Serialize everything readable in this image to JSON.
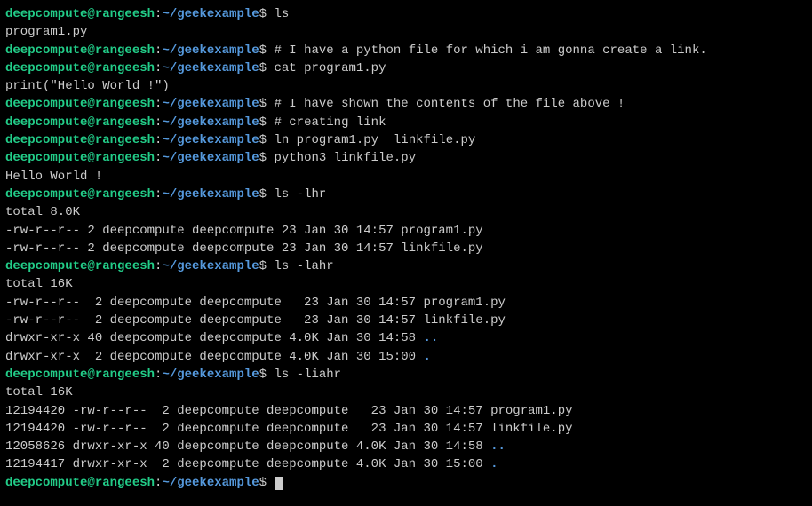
{
  "prompt": {
    "user_host": "deepcompute@rangeesh",
    "colon": ":",
    "path": "~/geekexample",
    "dollar": "$"
  },
  "lines": [
    {
      "type": "prompt",
      "cmd": "ls"
    },
    {
      "type": "output",
      "text": "program1.py"
    },
    {
      "type": "prompt",
      "cmd": "# I have a python file for which i am gonna create a link."
    },
    {
      "type": "prompt",
      "cmd": "cat program1.py"
    },
    {
      "type": "output",
      "text": "print(\"Hello World !\")"
    },
    {
      "type": "prompt",
      "cmd": "# I have shown the contents of the file above !"
    },
    {
      "type": "prompt",
      "cmd": "# creating link"
    },
    {
      "type": "prompt",
      "cmd": "ln program1.py  linkfile.py"
    },
    {
      "type": "prompt",
      "cmd": "python3 linkfile.py"
    },
    {
      "type": "output",
      "text": "Hello World !"
    },
    {
      "type": "prompt",
      "cmd": "ls -lhr"
    },
    {
      "type": "output",
      "text": "total 8.0K"
    },
    {
      "type": "output",
      "text": "-rw-r--r-- 2 deepcompute deepcompute 23 Jan 30 14:57 program1.py"
    },
    {
      "type": "output",
      "text": "-rw-r--r-- 2 deepcompute deepcompute 23 Jan 30 14:57 linkfile.py"
    },
    {
      "type": "prompt",
      "cmd": "ls -lahr"
    },
    {
      "type": "output",
      "text": "total 16K"
    },
    {
      "type": "output",
      "text": "-rw-r--r--  2 deepcompute deepcompute   23 Jan 30 14:57 program1.py"
    },
    {
      "type": "output",
      "text": "-rw-r--r--  2 deepcompute deepcompute   23 Jan 30 14:57 linkfile.py"
    },
    {
      "type": "output-dir",
      "prefix": "drwxr-xr-x 40 deepcompute deepcompute 4.0K Jan 30 14:58 ",
      "dir": ".."
    },
    {
      "type": "output-dir",
      "prefix": "drwxr-xr-x  2 deepcompute deepcompute 4.0K Jan 30 15:00 ",
      "dir": "."
    },
    {
      "type": "prompt",
      "cmd": "ls -liahr"
    },
    {
      "type": "output",
      "text": "total 16K"
    },
    {
      "type": "output",
      "text": "12194420 -rw-r--r--  2 deepcompute deepcompute   23 Jan 30 14:57 program1.py"
    },
    {
      "type": "output",
      "text": "12194420 -rw-r--r--  2 deepcompute deepcompute   23 Jan 30 14:57 linkfile.py"
    },
    {
      "type": "output-dir",
      "prefix": "12058626 drwxr-xr-x 40 deepcompute deepcompute 4.0K Jan 30 14:58 ",
      "dir": ".."
    },
    {
      "type": "output-dir",
      "prefix": "12194417 drwxr-xr-x  2 deepcompute deepcompute 4.0K Jan 30 15:00 ",
      "dir": "."
    },
    {
      "type": "prompt-cursor",
      "cmd": ""
    }
  ]
}
